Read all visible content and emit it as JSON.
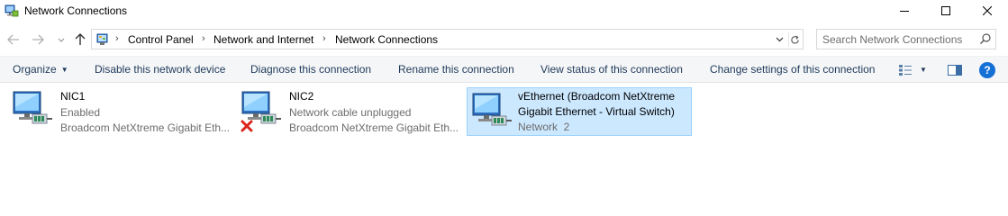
{
  "window": {
    "title": "Network Connections",
    "controls": [
      "minimize-icon",
      "maximize-icon",
      "close-icon"
    ]
  },
  "nav": {
    "breadcrumbs": [
      "Control Panel",
      "Network and Internet",
      "Network Connections"
    ],
    "search_placeholder": "Search Network Connections"
  },
  "commands": {
    "organize": "Organize",
    "disable": "Disable this network device",
    "diagnose": "Diagnose this connection",
    "rename": "Rename this connection",
    "view_status": "View status of this connection",
    "change_settings": "Change settings of this connection"
  },
  "connections": [
    {
      "name": "NIC1",
      "status": "Enabled",
      "device": "Broadcom NetXtreme Gigabit Eth...",
      "selected": false,
      "error": false
    },
    {
      "name": "NIC2",
      "status": "Network cable unplugged",
      "device": "Broadcom NetXtreme Gigabit Eth...",
      "selected": false,
      "error": true
    },
    {
      "name_line1": "vEthernet (Broadcom NetXtreme",
      "name_line2": "Gigabit Ethernet - Virtual Switch)",
      "status": "Network  2",
      "selected": true,
      "error": false
    }
  ],
  "colors": {
    "selection_bg": "#cce8ff",
    "selection_border": "#99d1ff",
    "command_text": "#1e395b",
    "help_blue": "#1570d6",
    "error_red": "#d9251d"
  }
}
